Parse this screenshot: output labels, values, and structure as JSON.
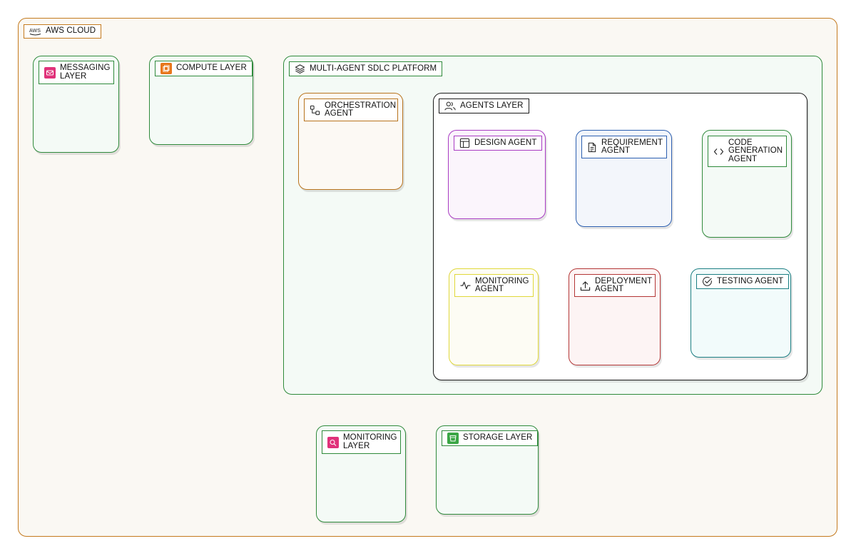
{
  "colors": {
    "aws_border": "#c47a1e",
    "aws_fill": "#faf8f3",
    "green_border": "#2f8a3b",
    "green_fill": "#f4faf6",
    "orange_border": "#b8741e",
    "orange_fill": "#fcf9f4",
    "black_border": "#1a1a1a",
    "purple_border": "#a83bc2",
    "purple_fill": "#fbf5fc",
    "blue_border": "#2c5fb0",
    "blue_fill": "#f3f6fb",
    "yellow_border": "#e0d83a",
    "yellow_fill": "#fdfcf4",
    "red_border": "#b33535",
    "red_fill": "#fdf4f4",
    "teal_border": "#1c7f83",
    "teal_fill": "#f2fbfb",
    "pink_icon": "#e0327a",
    "orange_icon": "#e8771c",
    "green_icon": "#3aa645"
  },
  "groups": {
    "aws_cloud": {
      "label": "AWS CLOUD",
      "icon": "aws-logo-icon"
    },
    "messaging_layer": {
      "label": "MESSAGING\nLAYER",
      "icon": "messaging-service-icon"
    },
    "compute_layer": {
      "label": "COMPUTE LAYER",
      "icon": "compute-service-icon"
    },
    "platform": {
      "label": "MULTI-AGENT SDLC PLATFORM",
      "icon": "layers-icon"
    },
    "orchestration_agent": {
      "label": "ORCHESTRATION\nAGENT",
      "icon": "workflow-icon"
    },
    "agents_layer": {
      "label": "AGENTS LAYER",
      "icon": "users-icon"
    },
    "design_agent": {
      "label": "DESIGN AGENT",
      "icon": "layout-icon"
    },
    "requirement_agent": {
      "label": "REQUIREMENT\nAGENT",
      "icon": "document-icon"
    },
    "code_generation_agent": {
      "label": "CODE\nGENERATION\nAGENT",
      "icon": "code-icon"
    },
    "monitoring_agent": {
      "label": "MONITORING\nAGENT",
      "icon": "activity-icon"
    },
    "deployment_agent": {
      "label": "DEPLOYMENT\nAGENT",
      "icon": "upload-icon"
    },
    "testing_agent": {
      "label": "TESTING AGENT",
      "icon": "check-circle-icon"
    },
    "monitoring_layer": {
      "label": "MONITORING\nLAYER",
      "icon": "monitoring-service-icon"
    },
    "storage_layer": {
      "label": "STORAGE LAYER",
      "icon": "storage-service-icon"
    }
  }
}
